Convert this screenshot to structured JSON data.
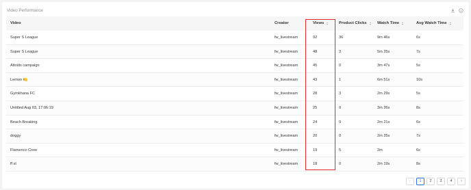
{
  "title": "Video Performance",
  "icons": [
    "download-icon",
    "info-icon"
  ],
  "columns": {
    "video": "Video",
    "creator": "Creator",
    "views": "Views",
    "clicks": "Product Clicks",
    "watch": "Watch Time",
    "avg": "Avg Watch Time"
  },
  "rows": [
    {
      "video": "Super S League",
      "creator": "fw_livestream",
      "views": "92",
      "clicks": "36",
      "watch": "9m 46s",
      "avg": "6s"
    },
    {
      "video": "Super S League",
      "creator": "fw_livestream",
      "views": "48",
      "clicks": "3",
      "watch": "5m 25s",
      "avg": "7s"
    },
    {
      "video": "Altoids campaign",
      "creator": "fw_livestream",
      "views": "45",
      "clicks": "0",
      "watch": "3m 47s",
      "avg": "5s"
    },
    {
      "video": "Lemon 🍋",
      "creator": "fw_livestream",
      "views": "43",
      "clicks": "1",
      "watch": "6m 51s",
      "avg": "10s"
    },
    {
      "video": "Gymkhana FC",
      "creator": "fw_livestream",
      "views": "28",
      "clicks": "3",
      "watch": "2m 29s",
      "avg": "5s"
    },
    {
      "video": "Untitled Aug 03, 17:06:19",
      "creator": "fw_livestream",
      "views": "25",
      "clicks": "0",
      "watch": "3m 26s",
      "avg": "8s"
    },
    {
      "video": "Beach Breaking",
      "creator": "fw_livestream",
      "views": "24",
      "clicks": "9",
      "watch": "2m 21s",
      "avg": "6s"
    },
    {
      "video": "doggy",
      "creator": "fw_livestream",
      "views": "20",
      "clicks": "0",
      "watch": "2m 25s",
      "avg": "7s"
    },
    {
      "video": "Flamenco Crew",
      "creator": "fw_livestream",
      "views": "19",
      "clicks": "5",
      "watch": "2m",
      "avg": "6s"
    },
    {
      "video": "ff                              st",
      "creator": "fw_livestream",
      "views": "18",
      "clicks": "0",
      "watch": "2m 19s",
      "avg": "8s"
    }
  ],
  "pagination": {
    "prev": "‹",
    "pages": [
      "1",
      "2",
      "3",
      "4"
    ],
    "next": "›",
    "current": "1"
  },
  "highlight_color": "#e0282a",
  "accent_color": "#2d6fe0"
}
